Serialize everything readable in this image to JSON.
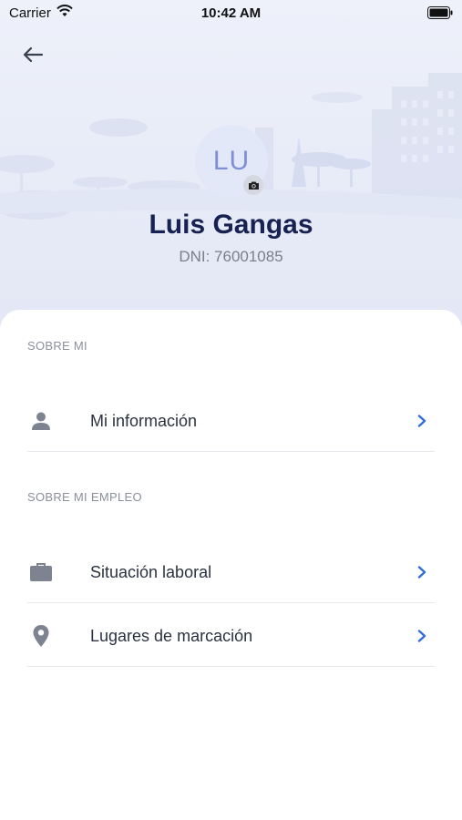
{
  "status_bar": {
    "carrier": "Carrier",
    "time": "10:42 AM"
  },
  "profile": {
    "initials": "LU",
    "name": "Luis Gangas",
    "dni": "DNI: 76001085"
  },
  "sections": {
    "sobre_mi": {
      "label": "SOBRE MI",
      "items": [
        {
          "label": "Mi información",
          "icon": "person-icon"
        }
      ]
    },
    "sobre_mi_empleo": {
      "label": "SOBRE MI EMPLEO",
      "items": [
        {
          "label": "Situación laboral",
          "icon": "briefcase-icon"
        },
        {
          "label": "Lugares de marcación",
          "icon": "location-pin-icon"
        }
      ]
    }
  },
  "colors": {
    "accent": "#2f6fdb",
    "title": "#172252",
    "icon": "#7d8390"
  }
}
